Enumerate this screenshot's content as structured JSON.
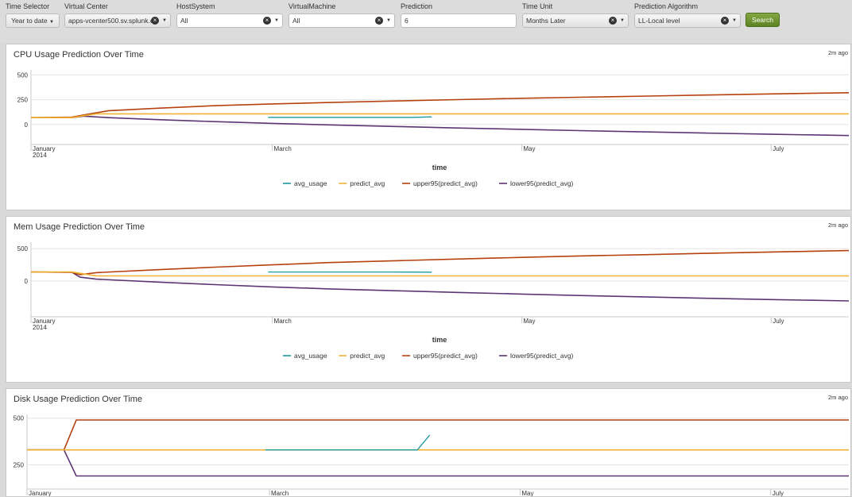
{
  "filters": {
    "time_selector": {
      "label": "Time Selector",
      "value": "Year to date"
    },
    "virtual_center": {
      "label": "Virtual Center",
      "value": "apps-vcenter500.sv.splunk.c"
    },
    "host_system": {
      "label": "HostSystem",
      "value": "All"
    },
    "virtual_machine": {
      "label": "VirtualMachine",
      "value": "All"
    },
    "prediction": {
      "label": "Prediction",
      "value": "6"
    },
    "time_unit": {
      "label": "Time Unit",
      "value": "Months Later"
    },
    "prediction_algorithm": {
      "label": "Prediction Algorithm",
      "value": "LL-Local level"
    },
    "search_label": "Search"
  },
  "colors": {
    "avg_usage": "#1f9aa0",
    "predict_avg": "#f2b132",
    "upper95": "#b6400e",
    "lower95": "#5c3572",
    "search_button": "#6d912f"
  },
  "panels": [
    {
      "title": "CPU Usage Prediction Over Time",
      "age": "2m ago"
    },
    {
      "title": "Mem Usage Prediction Over Time",
      "age": "2m ago"
    },
    {
      "title": "Disk Usage Prediction Over Time",
      "age": "2m ago"
    }
  ],
  "chart_data": [
    {
      "type": "line",
      "title": "CPU Usage Prediction Over Time",
      "xlabel": "time",
      "ylabel": "",
      "x_ticks": [
        "January",
        "March",
        "May",
        "July"
      ],
      "x_tick_sublabels": [
        "2014",
        "",
        "",
        ""
      ],
      "x_domain": [
        "2014-01-01",
        "2014-07-20"
      ],
      "y_ticks": [
        500,
        250,
        0
      ],
      "ylim": [
        -200,
        550
      ],
      "legend": [
        "avg_usage",
        "predict_avg",
        "upper95(predict_avg)",
        "lower95(predict_avg)"
      ],
      "legend_position": "bottom",
      "series": [
        {
          "name": "avg_usage",
          "x": [
            "2014-02-28",
            "2014-03-06",
            "2014-03-12",
            "2014-03-18",
            "2014-03-24",
            "2014-03-30",
            "2014-04-05",
            "2014-04-09"
          ],
          "y": [
            73,
            73,
            73,
            73,
            73,
            73,
            73,
            78
          ]
        },
        {
          "name": "predict_avg",
          "x": [
            "2014-01-01",
            "2014-01-11",
            "2014-01-14",
            "2014-01-17",
            "2014-07-20"
          ],
          "y": [
            70,
            70,
            90,
            108,
            108
          ]
        },
        {
          "name": "upper95(predict_avg)",
          "x": [
            "2014-01-01",
            "2014-01-11",
            "2014-01-15",
            "2014-01-20",
            "2014-02-01",
            "2014-02-15",
            "2014-03-01",
            "2014-03-15",
            "2014-04-01",
            "2014-04-15",
            "2014-05-01",
            "2014-05-15",
            "2014-06-01",
            "2014-06-15",
            "2014-07-01",
            "2014-07-20"
          ],
          "y": [
            70,
            75,
            105,
            140,
            165,
            190,
            208,
            222,
            238,
            251,
            264,
            275,
            287,
            297,
            308,
            320
          ]
        },
        {
          "name": "lower95(predict_avg)",
          "x": [
            "2014-01-01",
            "2014-01-11",
            "2014-01-14",
            "2014-01-20",
            "2014-02-01",
            "2014-02-15",
            "2014-03-01",
            "2014-03-15",
            "2014-04-01",
            "2014-04-15",
            "2014-05-01",
            "2014-05-15",
            "2014-06-01",
            "2014-06-15",
            "2014-07-01",
            "2014-07-20"
          ],
          "y": [
            70,
            70,
            85,
            70,
            50,
            30,
            12,
            -3,
            -20,
            -34,
            -48,
            -60,
            -74,
            -85,
            -97,
            -110
          ]
        }
      ]
    },
    {
      "type": "line",
      "title": "Mem Usage Prediction Over Time",
      "xlabel": "time",
      "ylabel": "",
      "x_ticks": [
        "January",
        "March",
        "May",
        "July"
      ],
      "x_tick_sublabels": [
        "2014",
        "",
        "",
        ""
      ],
      "x_domain": [
        "2014-01-01",
        "2014-07-20"
      ],
      "y_ticks": [
        500,
        0
      ],
      "ylim": [
        -550,
        600
      ],
      "legend": [
        "avg_usage",
        "predict_avg",
        "upper95(predict_avg)",
        "lower95(predict_avg)"
      ],
      "legend_position": "bottom",
      "series": [
        {
          "name": "avg_usage",
          "x": [
            "2014-02-28",
            "2014-03-10",
            "2014-03-20",
            "2014-03-30",
            "2014-04-09"
          ],
          "y": [
            140,
            140,
            140,
            140,
            137
          ]
        },
        {
          "name": "predict_avg",
          "x": [
            "2014-01-01",
            "2014-01-11",
            "2014-01-14",
            "2014-01-17",
            "2014-07-20"
          ],
          "y": [
            140,
            140,
            110,
            80,
            80
          ]
        },
        {
          "name": "upper95(predict_avg)",
          "x": [
            "2014-01-01",
            "2014-01-11",
            "2014-01-13",
            "2014-01-17",
            "2014-02-01",
            "2014-02-15",
            "2014-03-01",
            "2014-03-15",
            "2014-04-01",
            "2014-04-15",
            "2014-05-01",
            "2014-05-15",
            "2014-06-01",
            "2014-06-15",
            "2014-07-01",
            "2014-07-20"
          ],
          "y": [
            140,
            135,
            100,
            130,
            175,
            215,
            250,
            285,
            315,
            340,
            365,
            387,
            408,
            428,
            448,
            470
          ]
        },
        {
          "name": "lower95(predict_avg)",
          "x": [
            "2014-01-01",
            "2014-01-11",
            "2014-01-13",
            "2014-01-17",
            "2014-02-01",
            "2014-02-15",
            "2014-03-01",
            "2014-03-15",
            "2014-04-01",
            "2014-04-15",
            "2014-05-01",
            "2014-05-15",
            "2014-06-01",
            "2014-06-15",
            "2014-07-01",
            "2014-07-20"
          ],
          "y": [
            140,
            135,
            60,
            30,
            -15,
            -55,
            -90,
            -120,
            -150,
            -175,
            -200,
            -222,
            -245,
            -265,
            -285,
            -305
          ]
        }
      ]
    },
    {
      "type": "line",
      "title": "Disk Usage Prediction Over Time",
      "xlabel": "",
      "ylabel": "",
      "x_ticks": [
        "January",
        "March",
        "May",
        "July"
      ],
      "x_tick_sublabels": [
        "",
        "",
        "",
        ""
      ],
      "x_domain": [
        "2014-01-01",
        "2014-07-20"
      ],
      "y_ticks": [
        500,
        250
      ],
      "ylim": [
        120,
        520
      ],
      "legend": [],
      "series": [
        {
          "name": "avg_usage",
          "x": [
            "2014-02-28",
            "2014-03-10",
            "2014-03-20",
            "2014-03-30",
            "2014-04-06",
            "2014-04-09"
          ],
          "y": [
            330,
            330,
            330,
            330,
            330,
            410
          ]
        },
        {
          "name": "predict_avg",
          "x": [
            "2014-01-01",
            "2014-07-20"
          ],
          "y": [
            330,
            330
          ]
        },
        {
          "name": "upper95(predict_avg)",
          "x": [
            "2014-01-01",
            "2014-01-10",
            "2014-01-13",
            "2014-07-20"
          ],
          "y": [
            330,
            330,
            490,
            490
          ]
        },
        {
          "name": "lower95(predict_avg)",
          "x": [
            "2014-01-01",
            "2014-01-10",
            "2014-01-13",
            "2014-07-20"
          ],
          "y": [
            330,
            330,
            190,
            190
          ]
        }
      ]
    }
  ]
}
